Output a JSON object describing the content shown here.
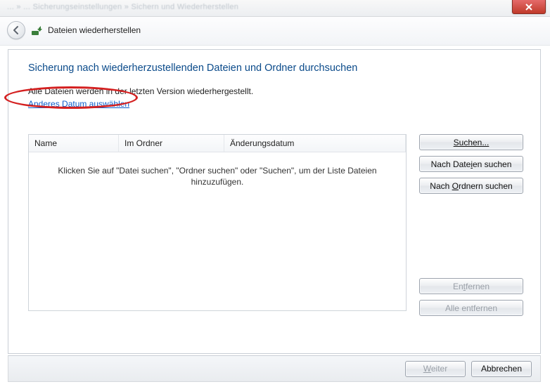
{
  "titlebar": {
    "breadcrumb_blur": "... » ... Sicherungseinstellungen » Sichern und Wiederherstellen"
  },
  "header": {
    "title": "Dateien wiederherstellen"
  },
  "main": {
    "heading": "Sicherung nach wiederherzustellenden Dateien und Ordner durchsuchen",
    "info_line": "Alle Dateien werden in der letzten Version wiederhergestellt.",
    "link_choose_date": "Anderes Datum auswählen"
  },
  "list": {
    "columns": {
      "name": "Name",
      "folder": "Im Ordner",
      "date": "Änderungsdatum"
    },
    "empty_text": "Klicken Sie auf \"Datei suchen\", \"Ordner suchen\" oder \"Suchen\", um der Liste Dateien hinzuzufügen."
  },
  "buttons": {
    "search": "Suchen...",
    "search_files_pre": "Nach Date",
    "search_files_u": "i",
    "search_files_post": "en suchen",
    "search_folders_pre": "Nach ",
    "search_folders_u": "O",
    "search_folders_post": "rdnern suchen",
    "remove_pre": "En",
    "remove_u": "t",
    "remove_post": "fernen",
    "remove_all": "Alle entfernen"
  },
  "footer": {
    "next_pre": "",
    "next_u": "W",
    "next_post": "eiter",
    "cancel": "Abbrechen"
  }
}
